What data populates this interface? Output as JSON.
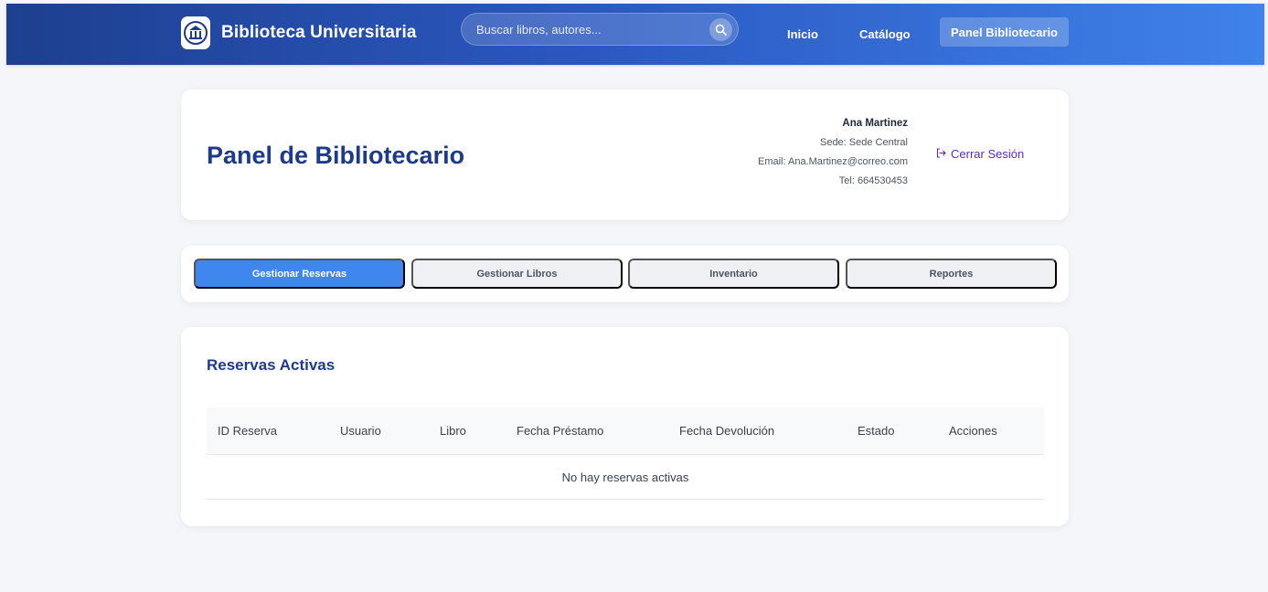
{
  "header": {
    "brand_title": "Biblioteca Universitaria",
    "logo_icon": "library-building-icon",
    "search": {
      "placeholder": "Buscar libros, autores..."
    },
    "nav": [
      {
        "label": "Inicio",
        "active": false
      },
      {
        "label": "Catálogo",
        "active": false
      },
      {
        "label": "Panel Bibliotecario",
        "active": true
      }
    ],
    "colors": {
      "gradient_start": "#1e3f8f",
      "gradient_end": "#3f82ea"
    }
  },
  "profile": {
    "page_title": "Panel de Bibliotecario",
    "user_name": "Ana Martinez",
    "sede": "Sede: Sede Central",
    "email": "Email: Ana.Martinez@correo.com",
    "tel": "Tel: 664530453",
    "logout_label": "Cerrar Sesión",
    "logout_icon": "logout-icon"
  },
  "tabs": [
    {
      "label": "Gestionar Reservas",
      "active": true
    },
    {
      "label": "Gestionar Libros",
      "active": false
    },
    {
      "label": "Inventario",
      "active": false
    },
    {
      "label": "Reportes",
      "active": false
    }
  ],
  "reservations": {
    "title": "Reservas Activas",
    "columns": [
      "ID Reserva",
      "Usuario",
      "Libro",
      "Fecha Préstamo",
      "Fecha Devolución",
      "Estado",
      "Acciones"
    ],
    "rows": [],
    "empty_message": "No hay reservas activas"
  },
  "accent_color": "#3f86ee",
  "title_color": "#1e3a8a"
}
